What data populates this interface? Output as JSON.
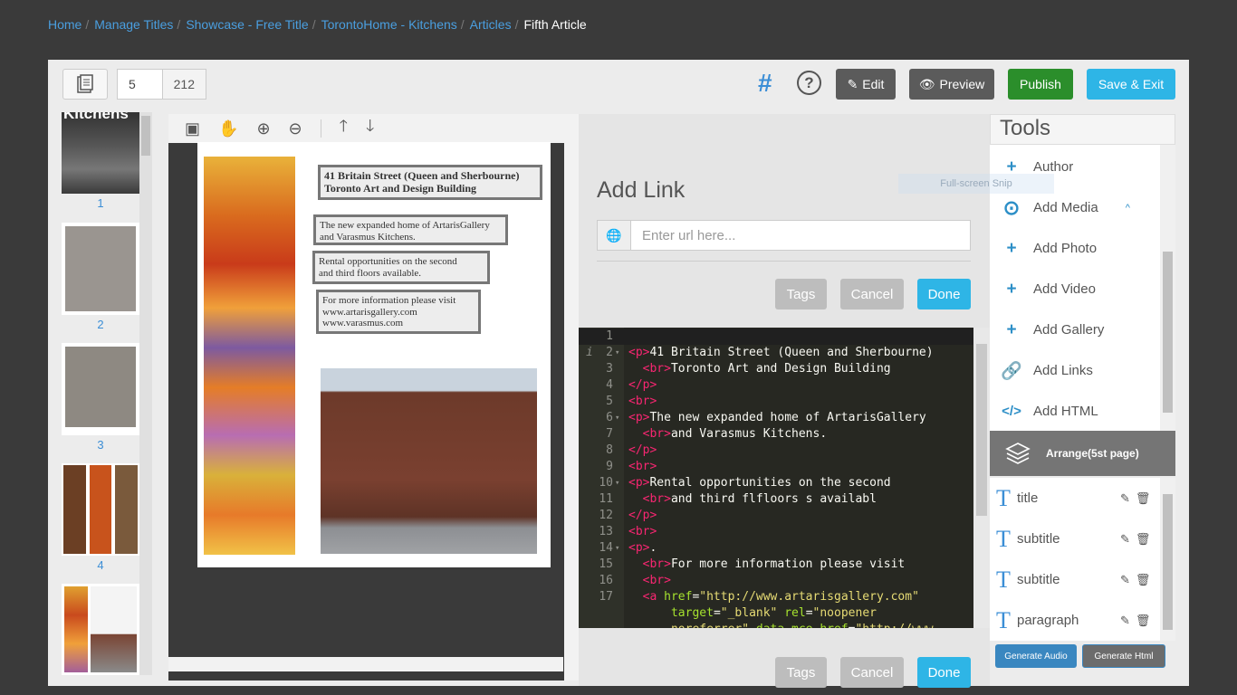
{
  "breadcrumb": [
    "Home",
    "Manage Titles",
    "Showcase - Free Title",
    "TorontoHome - Kitchens",
    "Articles",
    "Fifth Article"
  ],
  "toolbar": {
    "page_current": "5",
    "page_total": "212",
    "hash_symbol": "#",
    "help_symbol": "?",
    "edit_label": "Edit",
    "preview_label": "Preview",
    "publish_label": "Publish",
    "save_label": "Save & Exit"
  },
  "thumbnails": [
    "1",
    "2",
    "3",
    "4"
  ],
  "thumb1_text": "Kitchens",
  "page_content": {
    "box1": [
      "41 Britain Street (Queen and Sherbourne)",
      "Toronto Art and Design Building"
    ],
    "box2": [
      "The new expanded home of ArtarisGallery",
      "and Varasmus Kitchens."
    ],
    "box3": [
      "Rental opportunities on the second",
      "and third floors available."
    ],
    "box4": [
      "For more information please visit",
      "www.artarisgallery.com",
      "www.varasmus.com"
    ]
  },
  "add_link": {
    "title": "Add Link",
    "url_placeholder": "Enter url here...",
    "tags_label": "Tags",
    "cancel_label": "Cancel",
    "done_label": "Done"
  },
  "code_lines": [
    {
      "n": "1",
      "html": ""
    },
    {
      "n": "2",
      "html": "<span class=\"tg\">&lt;p&gt;</span>41 Britain Street (Queen and Sherbourne)"
    },
    {
      "n": "3",
      "html": "  <span class=\"tg\">&lt;br&gt;</span>Toronto Art and Design Building"
    },
    {
      "n": "4",
      "html": "<span class=\"tg\">&lt;/p&gt;</span>"
    },
    {
      "n": "5",
      "html": "<span class=\"tg\">&lt;br&gt;</span>"
    },
    {
      "n": "6",
      "html": "<span class=\"tg\">&lt;p&gt;</span>The new expanded home of ArtarisGallery"
    },
    {
      "n": "7",
      "html": "  <span class=\"tg\">&lt;br&gt;</span>and Varasmus Kitchens."
    },
    {
      "n": "8",
      "html": "<span class=\"tg\">&lt;/p&gt;</span>"
    },
    {
      "n": "9",
      "html": "<span class=\"tg\">&lt;br&gt;</span>"
    },
    {
      "n": "10",
      "html": "<span class=\"tg\">&lt;p&gt;</span>Rental opportunities on the second"
    },
    {
      "n": "11",
      "html": "  <span class=\"tg\">&lt;br&gt;</span>and third flfloors s availabl"
    },
    {
      "n": "12",
      "html": "<span class=\"tg\">&lt;/p&gt;</span>"
    },
    {
      "n": "13",
      "html": "<span class=\"tg\">&lt;br&gt;</span>"
    },
    {
      "n": "14",
      "html": "<span class=\"tg\">&lt;p&gt;</span>."
    },
    {
      "n": "15",
      "html": "  <span class=\"tg\">&lt;br&gt;</span>For more information please visit"
    },
    {
      "n": "16",
      "html": "  <span class=\"tg\">&lt;br&gt;</span>"
    },
    {
      "n": "17",
      "html": "  <span class=\"tg\">&lt;a</span> <span class=\"at\">href</span>=<span class=\"st\">\"http://www.artarisgallery.com\"</span>"
    },
    {
      "n": "",
      "html": "      <span class=\"at\">target</span>=<span class=\"st\">\"_blank\"</span> <span class=\"at\">rel</span>=<span class=\"st\">\"noopener</span>"
    },
    {
      "n": "",
      "html": "      <span class=\"st\">noreferrer\"</span> <span class=\"at\">data-mce-href</span>=<span class=\"st\">\"http://www.</span>"
    }
  ],
  "tools": {
    "title": "Tools",
    "items": [
      {
        "label": "Author",
        "icon": "plus-icon"
      },
      {
        "label": "Add Media",
        "icon": "play-circle-icon"
      },
      {
        "label": "Add Photo",
        "icon": "plus-icon"
      },
      {
        "label": "Add Video",
        "icon": "plus-icon"
      },
      {
        "label": "Add Gallery",
        "icon": "plus-icon"
      },
      {
        "label": "Add Links",
        "icon": "link-icon"
      },
      {
        "label": "Add HTML",
        "icon": "code-icon"
      }
    ],
    "arrange_label": "Arrange(5st page)",
    "layers": [
      {
        "name": "title"
      },
      {
        "name": "subtitle"
      },
      {
        "name": "subtitle"
      },
      {
        "name": "paragraph"
      }
    ],
    "generate_audio": "Generate Audio",
    "generate_html": "Generate Html"
  },
  "snip_label": "Full-screen Snip",
  "colors": {
    "accent_blue": "#2eb5e6",
    "publish_green": "#2b8e2b",
    "dark_button": "#5b5b5b",
    "editor_bg": "#272822"
  }
}
